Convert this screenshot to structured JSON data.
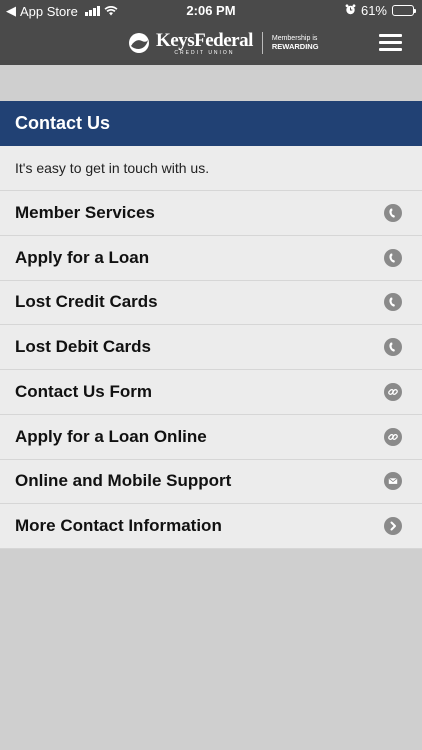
{
  "status_bar": {
    "back_app": "App Store",
    "time": "2:06 PM",
    "battery": "61%"
  },
  "brand": {
    "name": "KeysFederal",
    "subtitle": "CREDIT UNION",
    "tagline_top": "Membership is",
    "tagline_bottom": "REWARDING"
  },
  "page": {
    "title": "Contact Us",
    "intro": "It's easy to get in touch with us."
  },
  "items": [
    {
      "label": "Member Services",
      "icon": "phone-icon"
    },
    {
      "label": "Apply for a Loan",
      "icon": "phone-icon"
    },
    {
      "label": "Lost Credit Cards",
      "icon": "phone-icon"
    },
    {
      "label": "Lost Debit Cards",
      "icon": "phone-icon"
    },
    {
      "label": "Contact Us Form",
      "icon": "link-icon"
    },
    {
      "label": "Apply for a Loan Online",
      "icon": "link-icon"
    },
    {
      "label": "Online and Mobile Support",
      "icon": "mail-icon"
    },
    {
      "label": "More Contact Information",
      "icon": "chevron-right-icon"
    }
  ],
  "colors": {
    "topbar": "#4a4a4a",
    "header": "#214174",
    "row_bg": "#ececec",
    "page_bg": "#cfcfcf",
    "icon": "#8a8a8a"
  }
}
